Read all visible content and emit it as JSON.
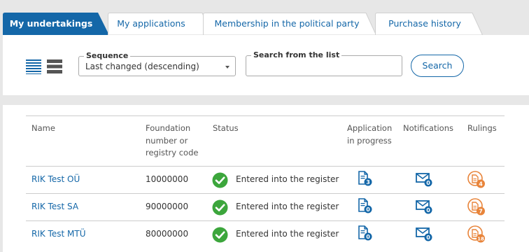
{
  "tabs": [
    {
      "label": "My undertakings",
      "active": true
    },
    {
      "label": "My applications",
      "active": false
    },
    {
      "label": "Membership in the political party",
      "active": false
    },
    {
      "label": "Purchase history",
      "active": false
    }
  ],
  "filters": {
    "sequence_label": "Sequence",
    "sequence_value": "Last changed (descending)",
    "search_label": "Search from the list",
    "search_value": "",
    "search_button": "Search"
  },
  "table": {
    "headers": {
      "name": "Name",
      "code_line1": "Foundation",
      "code_line2": "number or",
      "code_line3": "registry code",
      "status": "Status",
      "application_line1": "Application",
      "application_line2": "in progress",
      "notifications": "Notifications",
      "rulings": "Rulings"
    },
    "rows": [
      {
        "name": "RIK Test OÜ",
        "code": "10000000",
        "status": "Entered into the register",
        "applications": "3",
        "notifications": "0",
        "rulings": "4"
      },
      {
        "name": "RIK Test SA",
        "code": "90000000",
        "status": "Entered into the register",
        "applications": "0",
        "notifications": "0",
        "rulings": "7"
      },
      {
        "name": "RIK Test MTÜ",
        "code": "80000000",
        "status": "Entered into the register",
        "applications": "0",
        "notifications": "0",
        "rulings": "18"
      }
    ]
  },
  "colors": {
    "accent": "#1467a8",
    "status_ok": "#3ca63c",
    "ruling": "#e8843a"
  }
}
